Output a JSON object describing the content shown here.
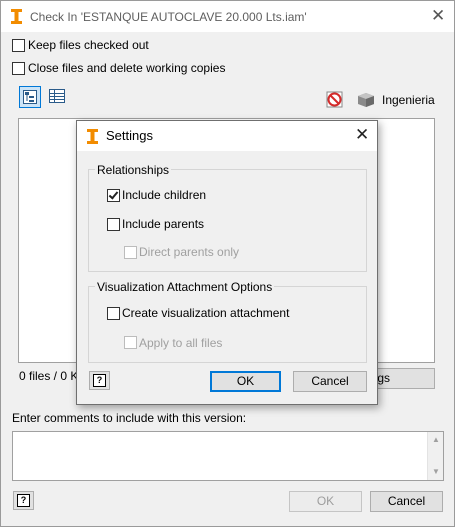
{
  "main_window": {
    "title": "Check In 'ESTANQUE AUTOCLAVE 20.000 Lts.iam'",
    "keep_checked_out_label": "Keep files checked out",
    "close_files_label": "Close files and delete working copies",
    "project_label": "Ingenieria",
    "status_text": "0 files / 0 KB",
    "settings_button_partial": "gs",
    "comments_label": "Enter comments to include with this version:",
    "comments_value": "",
    "ok_label": "OK",
    "cancel_label": "Cancel",
    "help_glyph": "?"
  },
  "settings_dialog": {
    "title": "Settings",
    "relationships_group": "Relationships",
    "include_children_label": "Include children",
    "include_children_checked": true,
    "include_parents_label": "Include parents",
    "include_parents_checked": false,
    "direct_parents_label": "Direct parents only",
    "direct_parents_checked": false,
    "visualization_group": "Visualization Attachment Options",
    "create_attachment_label": "Create visualization attachment",
    "create_attachment_checked": false,
    "apply_all_label": "Apply to all files",
    "apply_all_checked": false,
    "ok_label": "OK",
    "cancel_label": "Cancel",
    "help_glyph": "?"
  },
  "colors": {
    "accent": "#0078d7",
    "app_icon": "#f28c00",
    "no_entry_icon": "#d42b2b"
  }
}
